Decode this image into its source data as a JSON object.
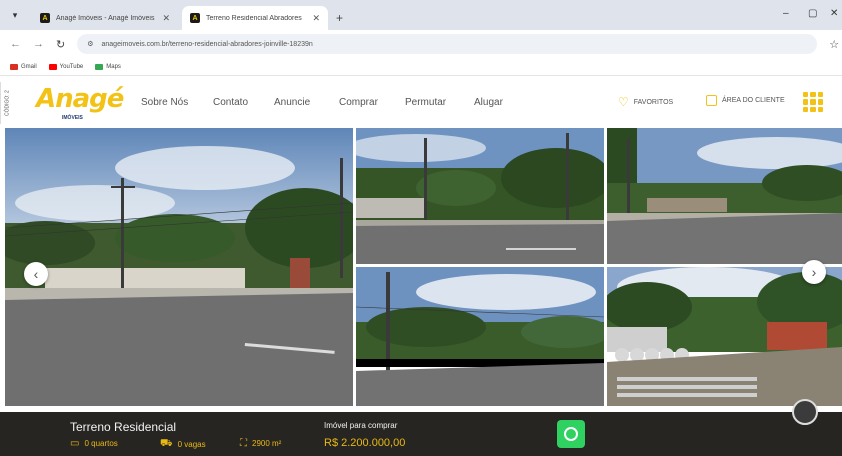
{
  "browser": {
    "tabs": [
      {
        "title": "Anagé Imóveis - Anagé Imóveis",
        "active": false
      },
      {
        "title": "Terreno Residencial Abradores",
        "active": true
      }
    ],
    "url": "anageimoveis.com.br/terreno-residencial-abradores-joinville-18239n",
    "bookmarks": [
      {
        "label": "Gmail",
        "color": "#d93025"
      },
      {
        "label": "YouTube",
        "color": "#ff0000"
      },
      {
        "label": "Maps",
        "color": "#34a853"
      }
    ]
  },
  "site": {
    "side_tab": "CÓDIGO: 2",
    "logo_word": "Anagé",
    "logo_sub": "IMÓVEIS",
    "nav": [
      "Sobre Nós",
      "Contato",
      "Anuncie",
      "Comprar",
      "Permutar",
      "Alugar"
    ],
    "favorites_label": "FAVORITOS",
    "client_area_label": "ÁREA DO CLIENTE"
  },
  "gallery": {
    "prev_icon": "chevron-left-icon",
    "next_icon": "chevron-right-icon"
  },
  "listing": {
    "title": "Terreno Residencial",
    "bedrooms": "0 quartos",
    "parking": "0 vagas",
    "area": "2900 m²",
    "price_label": "Imóvel para comprar",
    "price": "R$ 2.200.000,00",
    "whatsapp_icon": "whatsapp-icon"
  },
  "colors": {
    "brand_yellow": "#f2c316",
    "bottom_bar": "#272522",
    "whatsapp": "#2fd161"
  }
}
